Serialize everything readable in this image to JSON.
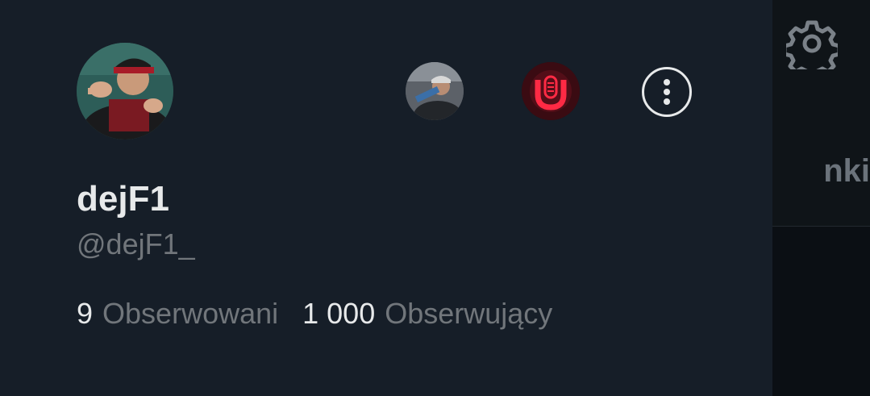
{
  "background": {
    "tab_label": "nki"
  },
  "profile": {
    "display_name": "dejF1",
    "handle": "@dejF1_"
  },
  "stats": {
    "following_count": "9",
    "following_label": "Obserwowani",
    "followers_count": "1 000",
    "followers_label": "Obserwujący"
  },
  "icons": {
    "settings": "gear-icon",
    "more": "more-vertical-icon"
  },
  "colors": {
    "drawer_bg": "#161e28",
    "text_primary": "#e7e9ea",
    "text_secondary": "#71767b",
    "accent_red": "#e0203a"
  }
}
